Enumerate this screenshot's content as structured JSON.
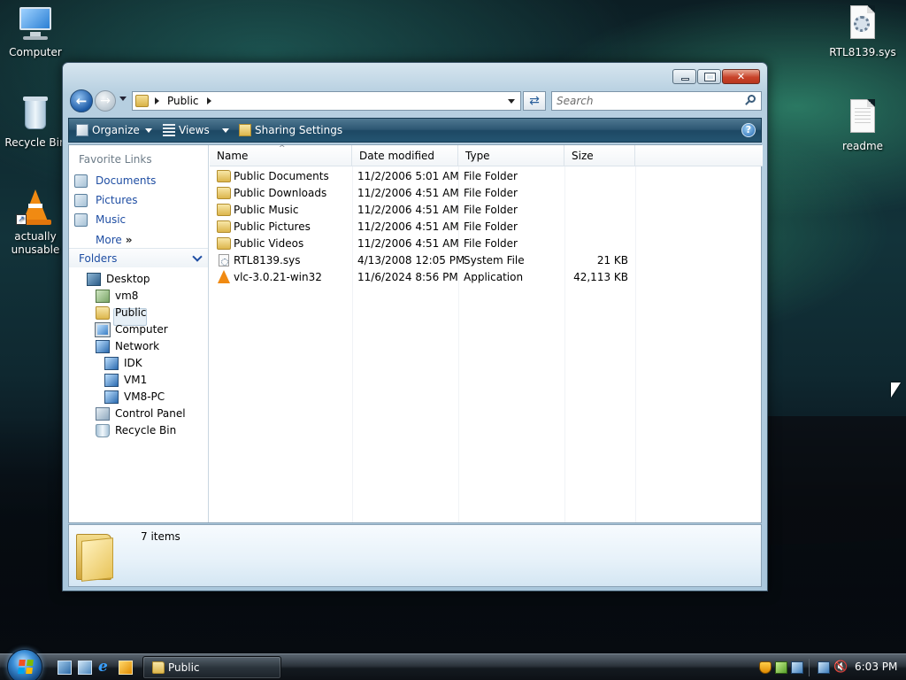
{
  "desktop": {
    "icons": [
      {
        "label": "Computer",
        "icon": "computer-icon"
      },
      {
        "label": "Recycle Bin",
        "icon": "recycle-bin-icon"
      },
      {
        "label": "actually\nunusable",
        "icon": "vlc-cone-icon"
      },
      {
        "label": "RTL8139.sys",
        "icon": "system-file-icon"
      },
      {
        "label": "readme",
        "icon": "text-document-icon"
      }
    ]
  },
  "window": {
    "address": {
      "path_segment": "Public",
      "search_placeholder": "Search"
    },
    "toolbar": {
      "organize": "Organize",
      "views": "Views",
      "sharing": "Sharing Settings",
      "help": "?"
    },
    "nav": {
      "favorites_title": "Favorite Links",
      "favorites": [
        "Documents",
        "Pictures",
        "Music"
      ],
      "more": "More",
      "folders_title": "Folders",
      "tree": [
        {
          "label": "Desktop",
          "icon": "desktop-icon"
        },
        {
          "label": "vm8",
          "icon": "user-folder-icon"
        },
        {
          "label": "Public",
          "icon": "folder-icon"
        },
        {
          "label": "Computer",
          "icon": "computer-icon"
        },
        {
          "label": "Network",
          "icon": "network-icon"
        },
        {
          "label": "IDK",
          "icon": "network-computer-icon"
        },
        {
          "label": "VM1",
          "icon": "network-computer-icon"
        },
        {
          "label": "VM8-PC",
          "icon": "network-computer-icon"
        },
        {
          "label": "Control Panel",
          "icon": "control-panel-icon"
        },
        {
          "label": "Recycle Bin",
          "icon": "recycle-bin-icon"
        }
      ]
    },
    "columns": [
      "Name",
      "Date modified",
      "Type",
      "Size"
    ],
    "files": [
      {
        "name": "Public Documents",
        "date": "11/2/2006 5:01 AM",
        "type": "File Folder",
        "size": "",
        "icon": "folder-icon"
      },
      {
        "name": "Public Downloads",
        "date": "11/2/2006 4:51 AM",
        "type": "File Folder",
        "size": "",
        "icon": "folder-icon"
      },
      {
        "name": "Public Music",
        "date": "11/2/2006 4:51 AM",
        "type": "File Folder",
        "size": "",
        "icon": "folder-icon"
      },
      {
        "name": "Public Pictures",
        "date": "11/2/2006 4:51 AM",
        "type": "File Folder",
        "size": "",
        "icon": "folder-icon"
      },
      {
        "name": "Public Videos",
        "date": "11/2/2006 4:51 AM",
        "type": "File Folder",
        "size": "",
        "icon": "folder-icon"
      },
      {
        "name": "RTL8139.sys",
        "date": "4/13/2008 12:05 PM",
        "type": "System File",
        "size": "21 KB",
        "icon": "system-file-icon"
      },
      {
        "name": "vlc-3.0.21-win32",
        "date": "11/6/2024 8:56 PM",
        "type": "Application",
        "size": "42,113 KB",
        "icon": "vlc-cone-icon"
      }
    ],
    "details": {
      "item_count": "7 items"
    }
  },
  "taskbar": {
    "task_button": "Public",
    "clock": "6:03 PM"
  }
}
